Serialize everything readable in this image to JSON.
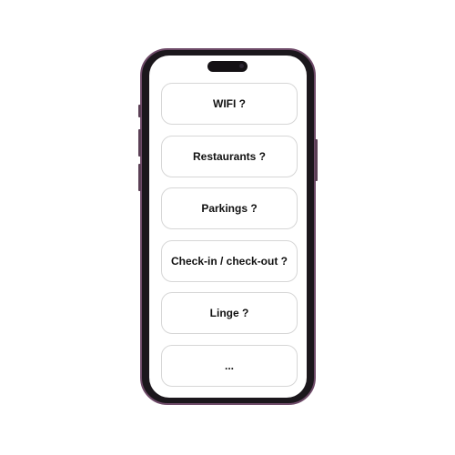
{
  "menu": {
    "items": [
      {
        "label": "WIFI ?"
      },
      {
        "label": "Restaurants ?"
      },
      {
        "label": "Parkings ?"
      },
      {
        "label": "Check-in / check-out ?"
      },
      {
        "label": "Linge ?"
      },
      {
        "label": "..."
      }
    ]
  },
  "colors": {
    "frame": "#1b171c",
    "frame_edge": "#6e4a68",
    "card_border": "#d6d6d6",
    "text": "#111111"
  }
}
